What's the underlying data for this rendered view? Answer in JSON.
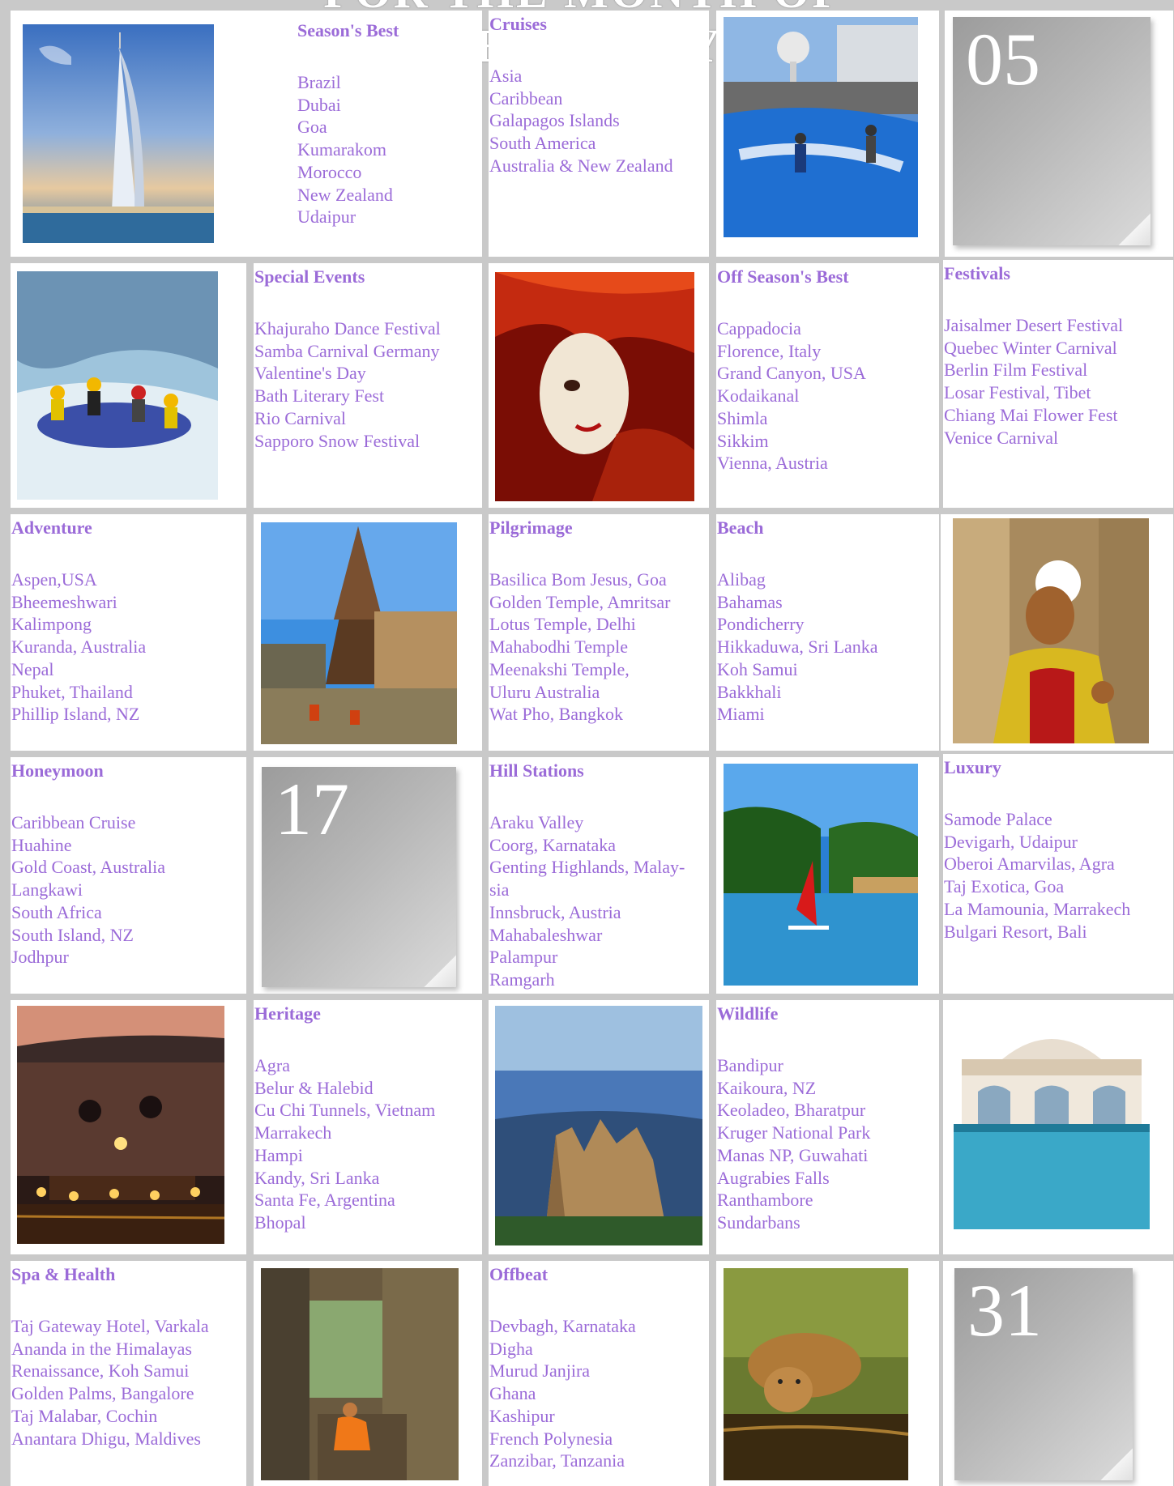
{
  "header": {
    "title": "FOR THE MONTH OF FEBRUARY"
  },
  "categories": {
    "seasons_best": {
      "title": "Season's Best",
      "items": [
        "Brazil",
        "Dubai",
        "Goa",
        "Kumarakom",
        "Morocco",
        "New Zealand",
        "Udaipur"
      ]
    },
    "cruises": {
      "title": "Cruises",
      "items": [
        "Asia",
        "Caribbean",
        "Galapagos Islands",
        "South America",
        "Australia & New Zealand"
      ]
    },
    "special_events": {
      "title": "Special Events",
      "items": [
        "Khajuraho Dance Festival",
        "Samba Carnival Germany",
        "Valentine's Day",
        "Bath Literary Fest",
        "Rio Carnival",
        "Sapporo Snow Festival"
      ]
    },
    "off_season": {
      "title": "Off Season's Best",
      "items": [
        "Cappadocia",
        "Florence, Italy",
        "Grand Canyon, USA",
        "Kodaikanal",
        "Shimla",
        "Sikkim",
        "Vienna, Austria"
      ]
    },
    "festivals": {
      "title": "Festivals",
      "items": [
        "Jaisalmer Desert Festival",
        "Quebec Winter Carnival",
        "Berlin Film Festival",
        "Losar Festival, Tibet",
        "Chiang Mai Flower Fest",
        "Venice Carnival"
      ]
    },
    "adventure": {
      "title": "Adventure",
      "items": [
        "Aspen,USA",
        "Bheemeshwari",
        "Kalimpong",
        "Kuranda, Australia",
        "Nepal",
        "Phuket, Thailand",
        "Phillip Island, NZ"
      ]
    },
    "pilgrimage": {
      "title": "Pilgrimage",
      "items": [
        "Basilica Bom Jesus, Goa",
        "Golden Temple, Amritsar",
        "Lotus Temple, Delhi",
        "Mahabodhi Temple",
        "Meenakshi Temple,",
        "Uluru Australia",
        "Wat Pho, Bangkok"
      ]
    },
    "beach": {
      "title": "Beach",
      "items": [
        "Alibag",
        "Bahamas",
        "Pondicherry",
        "Hikkaduwa, Sri Lanka",
        "Koh Samui",
        "Bakkhali",
        "Miami"
      ]
    },
    "honeymoon": {
      "title": "Honeymoon",
      "items": [
        "Caribbean Cruise",
        "Huahine",
        "Gold Coast, Australia",
        "Langkawi",
        "South Africa",
        "South Island, NZ",
        "Jodhpur"
      ]
    },
    "hill_stations": {
      "title": "Hill Stations",
      "items": [
        "Araku Valley",
        "Coorg, Karnataka",
        "Genting Highlands, Malay-",
        "sia",
        "Innsbruck, Austria",
        "Mahabaleshwar",
        "Palampur",
        "Ramgarh"
      ]
    },
    "luxury": {
      "title": "Luxury",
      "items": [
        "Samode Palace",
        "Devigarh, Udaipur",
        "Oberoi Amarvilas, Agra",
        "Taj Exotica, Goa",
        "La Mamounia, Marrakech",
        "Bulgari Resort, Bali"
      ]
    },
    "heritage": {
      "title": "Heritage",
      "items": [
        "Agra",
        "Belur & Halebid",
        "Cu Chi Tunnels, Vietnam",
        "Marrakech",
        "Hampi",
        "Kandy, Sri Lanka",
        "Santa Fe, Argentina",
        "Bhopal"
      ]
    },
    "wildlife": {
      "title": "Wildlife",
      "items": [
        "Bandipur",
        "Kaikoura, NZ",
        "Keoladeo, Bharatpur",
        "Kruger National Park",
        "Manas NP, Guwahati",
        "Augrabies Falls",
        "Ranthambore",
        "Sundarbans"
      ]
    },
    "spa": {
      "title": "Spa & Health",
      "items": [
        "Taj Gateway Hotel, Varkala",
        "Ananda in the Himalayas",
        "Renaissance, Koh Samui",
        "Golden Palms, Bangalore",
        "Taj Malabar, Cochin",
        "Anantara Dhigu, Maldives"
      ]
    },
    "offbeat": {
      "title": "Offbeat",
      "items": [
        "Devbagh, Karnataka",
        "Digha",
        "Murud Janjira",
        "Ghana",
        "Kashipur",
        "French Polynesia",
        "Zanzibar, Tanzania"
      ]
    }
  },
  "dates": {
    "d1": "05",
    "d2": "17",
    "d3": "31"
  },
  "colors": {
    "link": "#9b6bd8",
    "grid": "#c9c9c9",
    "card": "#aaaaaa"
  },
  "photos": [
    "burj-al-arab",
    "cruise-ship-surf",
    "river-rafting",
    "venice-carnival-mask",
    "temple-gopuram",
    "classical-dancer",
    "tropical-beach-windsurf",
    "candlelit-dinner",
    "three-sisters-mountains",
    "palace-pool",
    "monk-at-ruins",
    "lion-drinking"
  ]
}
